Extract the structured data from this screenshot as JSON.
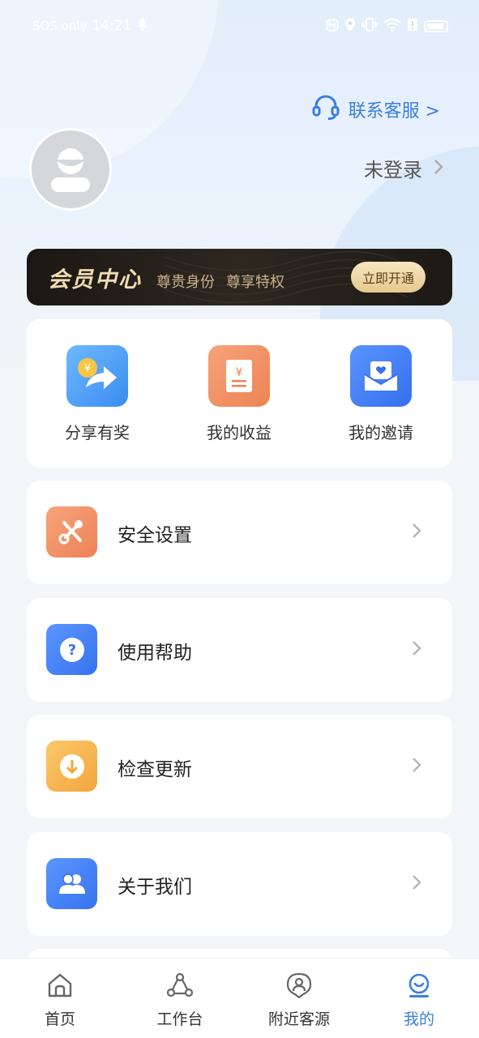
{
  "status_bar": {
    "carrier": "SOS only",
    "time": "14:21"
  },
  "header": {
    "contact_label": "联系客服 >",
    "login_label": "未登录"
  },
  "member": {
    "title": "会员中心",
    "subtitle_1": "尊贵身份",
    "subtitle_2": "尊享特权",
    "button": "立即开通"
  },
  "shortcuts": [
    {
      "label": "分享有奖",
      "icon": "share-reward-icon"
    },
    {
      "label": "我的收益",
      "icon": "earnings-icon"
    },
    {
      "label": "我的邀请",
      "icon": "invitation-icon"
    }
  ],
  "menu": [
    {
      "label": "安全设置",
      "icon": "tools-icon"
    },
    {
      "label": "使用帮助",
      "icon": "help-icon"
    },
    {
      "label": "检查更新",
      "icon": "download-icon"
    },
    {
      "label": "关于我们",
      "icon": "people-icon"
    }
  ],
  "tabs": [
    {
      "label": "首页",
      "icon": "home-icon"
    },
    {
      "label": "工作台",
      "icon": "workbench-icon"
    },
    {
      "label": "附近客源",
      "icon": "nearby-clients-icon"
    },
    {
      "label": "我的",
      "icon": "profile-icon",
      "active": true
    }
  ],
  "colors": {
    "accent": "#3b7ee0",
    "member_gold": "#f0dcb0",
    "member_bg": "#1b1714"
  }
}
